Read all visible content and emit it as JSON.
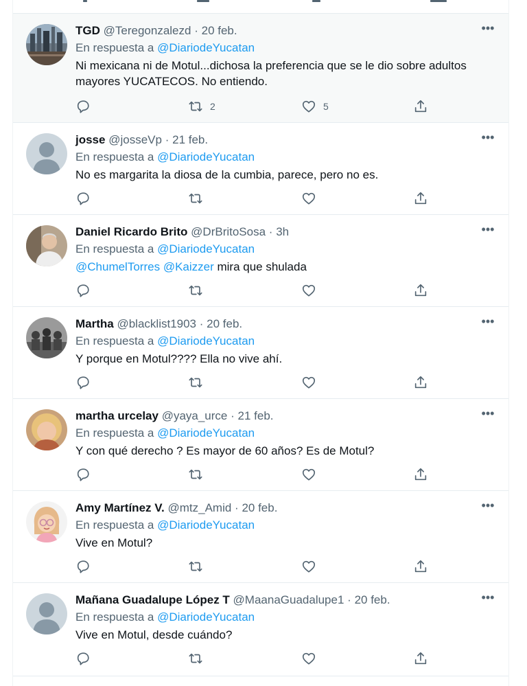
{
  "reply_prefix": "En respuesta a",
  "tweets": [
    {
      "name": "TGD",
      "handle": "@Teregonzalezd",
      "date": "20 feb.",
      "reply_to": "@DiariodeYucatan",
      "text": "Ni mexicana ni de Motul...dichosa la preferencia que se le dio sobre adultos mayores YUCATECOS. No entiendo.",
      "retweets": "2",
      "likes": "5",
      "avatar": "photo-city-icon"
    },
    {
      "name": "josse",
      "handle": "@josseVp",
      "date": "21 feb.",
      "reply_to": "@DiariodeYucatan",
      "text": "No es margarita la diosa  de la cumbia, parece,  pero no es.",
      "retweets": "",
      "likes": "",
      "avatar": "default-avatar-icon"
    },
    {
      "name": "Daniel Ricardo Brito",
      "handle": "@DrBritoSosa",
      "date": "3h",
      "reply_to": "@DiariodeYucatan",
      "mentions": [
        "@ChumelTorres",
        "@Kaizzer"
      ],
      "text": " mira que shulada",
      "retweets": "",
      "likes": "",
      "avatar": "photo-man-icon"
    },
    {
      "name": "Martha",
      "handle": "@blacklist1903",
      "date": "20 feb.",
      "reply_to": "@DiariodeYucatan",
      "text": "Y porque en Motul????  Ella no vive ahí.",
      "retweets": "",
      "likes": "",
      "avatar": "photo-group-icon"
    },
    {
      "name": "martha urcelay",
      "handle": "@yaya_urce",
      "date": "21 feb.",
      "reply_to": "@DiariodeYucatan",
      "text": "Y con qué derecho ? Es mayor de 60 años? Es de Motul?",
      "retweets": "",
      "likes": "",
      "avatar": "photo-woman-icon"
    },
    {
      "name": "Amy Martínez V.",
      "handle": "@mtz_Amid",
      "date": "20 feb.",
      "reply_to": "@DiariodeYucatan",
      "text": "Vive en Motul?",
      "retweets": "",
      "likes": "",
      "avatar": "memoji-avatar-icon"
    },
    {
      "name": "Mañana Guadalupe López T",
      "handle": "@MaanaGuadalupe1",
      "date": "20 feb.",
      "reply_to": "@DiariodeYucatan",
      "text": "Vive en Motul, desde cuándo?",
      "retweets": "",
      "likes": "",
      "avatar": "default-avatar-icon"
    }
  ],
  "colors": {
    "link": "#1d9bf0",
    "secondary_text": "#536471",
    "primary_text": "#0f1419",
    "highlight_bg": "#f7f9f9",
    "divider": "#e6ecf0"
  }
}
